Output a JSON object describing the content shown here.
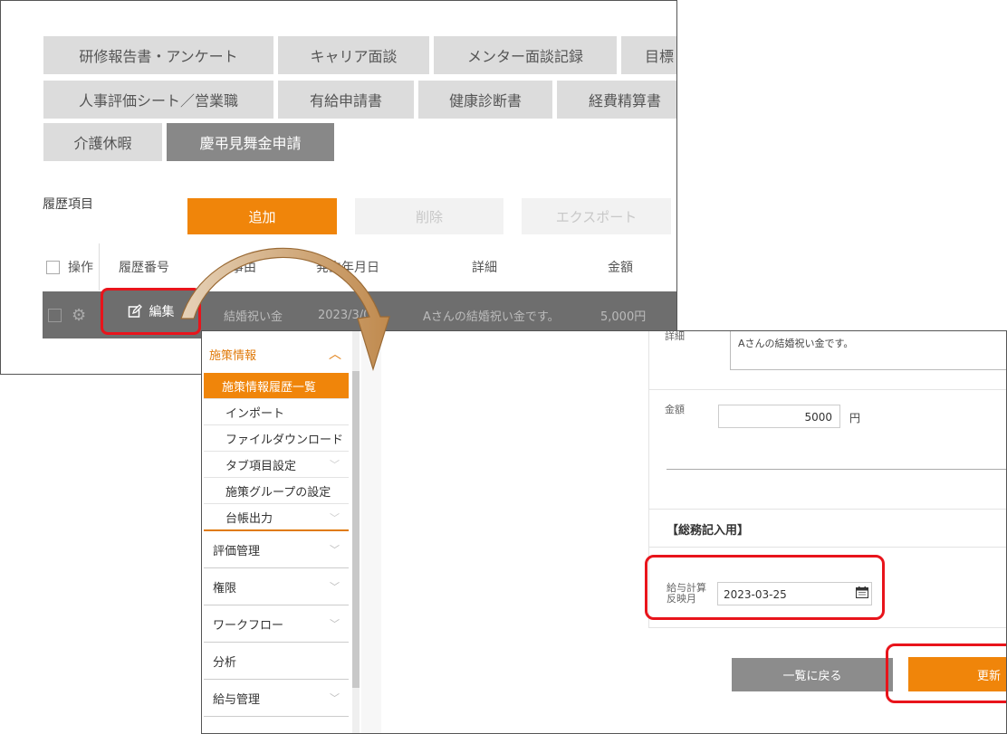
{
  "tabs": {
    "row1": [
      "研修報告書・アンケート",
      "キャリア面談",
      "メンター面談記録",
      "目標"
    ],
    "row2": [
      "人事評価シート／営業職",
      "有給申請書",
      "健康診断書",
      "経費精算書"
    ],
    "row3": [
      "介護休暇",
      "慶弔見舞金申請"
    ]
  },
  "history": {
    "label": "履歴項目",
    "add": "追加",
    "delete": "削除",
    "export": "エクスポート",
    "columns": {
      "op": "操作",
      "no": "履歴番号",
      "reason": "事由",
      "date": "発生年月日",
      "detail": "詳細",
      "amount": "金額"
    },
    "row": {
      "edit": "編集",
      "reason": "結婚祝い金",
      "date": "2023/3/01",
      "detail": "Aさんの結婚祝い金です。",
      "amount": "5,000円"
    }
  },
  "sidebar": {
    "section": "施策情報",
    "sub": [
      "施策情報履歴一覧",
      "インポート",
      "ファイルダウンロード",
      "タブ項目設定",
      "施策グループの設定",
      "台帳出力"
    ],
    "items": [
      "評価管理",
      "権限",
      "ワークフロー",
      "分析",
      "給与管理"
    ]
  },
  "form": {
    "detail_label": "詳細",
    "detail_value": "Aさんの結婚祝い金です。",
    "amount_label": "金額",
    "amount_value": "5000",
    "amount_unit": "円",
    "section_title": "【総務記入用】",
    "payroll_label_1": "給与計算",
    "payroll_label_2": "反映月",
    "payroll_date": "2023-03-25",
    "back": "一覧に戻る",
    "update": "更新"
  },
  "colors": {
    "accent": "#f0850a",
    "highlight": "#e8141b",
    "tab_active": "#888888",
    "tab_inactive": "#dcdcdc"
  }
}
